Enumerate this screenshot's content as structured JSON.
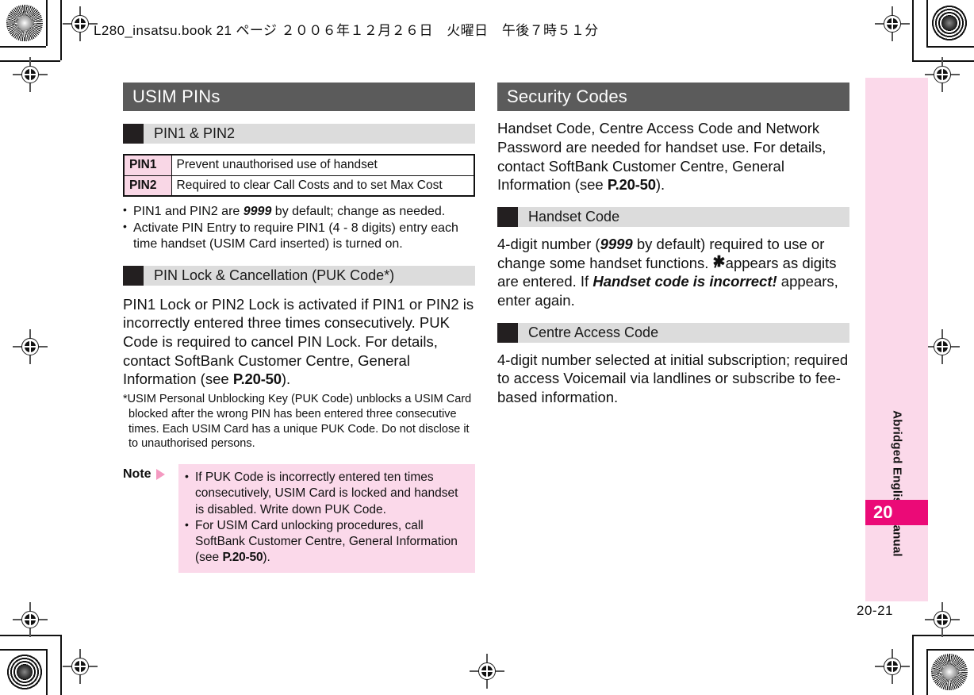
{
  "header": {
    "line": "L280_insatsu.book 21 ページ ２００６年１２月２６日　火曜日　午後７時５１分"
  },
  "left_column": {
    "section_title": "USIM PINs",
    "subsections": [
      {
        "label": "PIN1 & PIN2"
      },
      {
        "label": "PIN Lock & Cancellation (PUK Code*)"
      }
    ],
    "pin_table": {
      "rows": [
        {
          "key": "PIN1",
          "desc": "Prevent unauthorised use of handset"
        },
        {
          "key": "PIN2",
          "desc": "Required to clear Call Costs and to set Max Cost"
        }
      ]
    },
    "bullets": [
      "PIN1 and PIN2 are 9999 by default; change as needed.",
      "Activate PIN Entry to require PIN1 (4 - 8 digits) entry each time handset (USIM Card inserted) is turned on."
    ],
    "bullet1_pre": "PIN1 and PIN2 are ",
    "bullet1_em": "9999",
    "bullet1_post": " by default; change as needed.",
    "lock_paragraph_pre": "PIN1 Lock or PIN2 Lock is activated if PIN1 or PIN2 is incorrectly entered three times consecutively. PUK Code is required to cancel PIN Lock. For details, contact SoftBank Customer Centre, General Information (see ",
    "lock_paragraph_ref": "P.20-50",
    "lock_paragraph_post": ").",
    "footnote": "*USIM Personal Unblocking Key (PUK Code) unblocks a USIM Card blocked after the wrong PIN has been entered three consecutive times. Each USIM Card has a unique PUK Code. Do not disclose it to unauthorised persons.",
    "note": {
      "label": "Note",
      "items": [
        "If PUK Code is incorrectly entered ten times consecutively, USIM Card is locked and handset is disabled. Write down PUK Code.",
        "For USIM Card unlocking procedures, call SoftBank Customer Centre, General Information (see P.20-50)."
      ],
      "item2_pre": "For USIM Card unlocking procedures, call SoftBank Customer Centre, General Information (see ",
      "item2_ref": "P.20-50",
      "item2_post": ")."
    }
  },
  "right_column": {
    "section_title": "Security Codes",
    "intro_pre": "Handset Code, Centre Access Code and Network Password are needed for handset use. For details, contact SoftBank Customer Centre, General Information (see ",
    "intro_ref": "P.20-50",
    "intro_post": ").",
    "subsections": [
      {
        "label": "Handset Code"
      },
      {
        "label": "Centre Access Code"
      }
    ],
    "handset_code": {
      "p1": "4-digit number (",
      "em1": "9999",
      "p2": " by default) required to use or change some handset functions. ",
      "glyph": "✱",
      "p3": " appears as digits are entered. If ",
      "em2": "Handset code is incorrect!",
      "p4": " appears, enter again."
    },
    "centre_access_code": {
      "body": "4-digit number selected at initial subscription; required to access Voicemail via landlines or subscribe to fee-based information."
    }
  },
  "side_tab": {
    "manual_label": "Abridged English Manual",
    "chapter_number": "20"
  },
  "folio": "20-21",
  "colors": {
    "section_bar": "#5b5b5b",
    "subsection_bar": "#dcdcdc",
    "subsection_block": "#231f20",
    "pink_light": "#fbd9ea",
    "pink_table": "#f9d7e6",
    "magenta": "#eb0a77",
    "note_arrow": "#f49ac1"
  }
}
